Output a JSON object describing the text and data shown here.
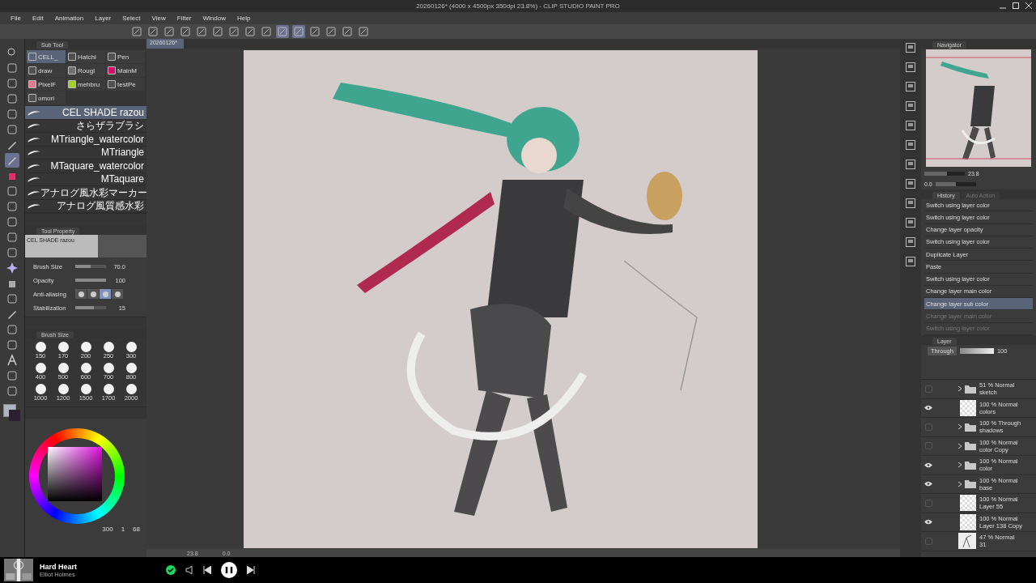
{
  "window": {
    "title": "20260126* (4000 x 4500px 350dpi 23.8%)  - CLIP STUDIO PAINT PRO"
  },
  "menu": [
    "File",
    "Edit",
    "Animation",
    "Layer",
    "Select",
    "View",
    "Filter",
    "Window",
    "Help"
  ],
  "document_tab": {
    "label": "20260126*"
  },
  "tools": [
    {
      "kind": "zoom",
      "selected": false
    },
    {
      "kind": "hand",
      "selected": false
    },
    {
      "kind": "pick",
      "selected": false
    },
    {
      "kind": "move",
      "selected": false
    },
    {
      "kind": "lasso",
      "selected": false
    },
    {
      "kind": "wand",
      "selected": false
    },
    {
      "kind": "dropper",
      "selected": false
    },
    {
      "kind": "pen",
      "selected": true
    },
    {
      "kind": "brush",
      "selected": false
    },
    {
      "kind": "airbrush",
      "selected": false
    },
    {
      "kind": "stamp",
      "selected": false
    },
    {
      "kind": "blend",
      "selected": false
    },
    {
      "kind": "eraser",
      "selected": false
    },
    {
      "kind": "frame",
      "selected": false
    },
    {
      "kind": "star",
      "selected": false
    },
    {
      "kind": "fill",
      "selected": false
    },
    {
      "kind": "gradient",
      "selected": false
    },
    {
      "kind": "line",
      "selected": false
    },
    {
      "kind": "panel",
      "selected": false
    },
    {
      "kind": "ruler",
      "selected": false
    },
    {
      "kind": "text",
      "selected": false
    },
    {
      "kind": "burst",
      "selected": false
    },
    {
      "kind": "select",
      "selected": false
    }
  ],
  "sub_tool": {
    "title": "Sub Tool",
    "groups": [
      {
        "label": "CELL_",
        "selected": true,
        "color": "#5a6478"
      },
      {
        "label": "Hatchi",
        "selected": false,
        "color": "#505050"
      },
      {
        "label": "Pen",
        "selected": false,
        "color": "#505050"
      },
      {
        "label": "draw",
        "selected": false,
        "color": "#505050"
      },
      {
        "label": "Rougl",
        "selected": false,
        "color": "#707070"
      },
      {
        "label": "MainM",
        "selected": false,
        "color": "#d0106a"
      },
      {
        "label": "PixelF",
        "selected": false,
        "color": "#e87890"
      },
      {
        "label": "mehbru",
        "selected": false,
        "color": "#a8d020"
      },
      {
        "label": "testPe",
        "selected": false,
        "color": "#505050"
      },
      {
        "label": "omori",
        "selected": false,
        "color": "#505050"
      }
    ],
    "brushes": [
      {
        "name": "CEL SHADE razou",
        "selected": true
      },
      {
        "name": "さらザラブラシ",
        "selected": false
      },
      {
        "name": "MTriangle_watercolor",
        "selected": false
      },
      {
        "name": "MTriangle",
        "selected": false
      },
      {
        "name": "MTaquare_watercolor",
        "selected": false
      },
      {
        "name": "MTaquare",
        "selected": false
      },
      {
        "name": "アナログ風水彩マーカー",
        "selected": false
      },
      {
        "name": "アナログ風質感水彩",
        "selected": false
      }
    ]
  },
  "tool_property": {
    "title": "Tool Property",
    "brush_name": "CEL SHADE razou",
    "rows": [
      {
        "kind": "slider",
        "label": "Brush Size",
        "value": "70.0",
        "level": 0.5
      },
      {
        "kind": "slider",
        "label": "Opacity",
        "value": "100",
        "level": 1
      },
      {
        "kind": "segments",
        "label": "Anti-aliasing",
        "options": [
          {
            "selected": false
          },
          {
            "selected": false
          },
          {
            "selected": true
          },
          {
            "selected": false
          }
        ]
      },
      {
        "kind": "slider",
        "label": "Stabilization",
        "value": "15",
        "level": 0.6
      }
    ]
  },
  "brush_size": {
    "title": "Brush Size",
    "sizes": [
      "150",
      "170",
      "200",
      "250",
      "300",
      "400",
      "500",
      "600",
      "700",
      "800",
      "1000",
      "1200",
      "1500",
      "1700",
      "2000"
    ]
  },
  "color_panel": {
    "readouts": [
      "300",
      "1",
      "68"
    ]
  },
  "canvas": {
    "zoom": "23.8",
    "angle": "0.0"
  },
  "navigator": {
    "title": "Navigator",
    "zoom": "23.8",
    "angle": "0.0",
    "zoom_slider": {
      "level": 0.55
    },
    "rotate_slider": {
      "level": 0.5
    }
  },
  "history": {
    "tabs": [
      {
        "label": "History",
        "selected": true
      },
      {
        "label": "Auto Action",
        "selected": false
      }
    ],
    "items": [
      {
        "label": "Switch using layer color",
        "selected": false,
        "disabled": false
      },
      {
        "label": "Switch using layer color",
        "selected": false,
        "disabled": false
      },
      {
        "label": "Change layer opacity",
        "selected": false,
        "disabled": false
      },
      {
        "label": "Switch using layer color",
        "selected": false,
        "disabled": false
      },
      {
        "label": "Duplicate Layer",
        "selected": false,
        "disabled": false
      },
      {
        "label": "Paste",
        "selected": false,
        "disabled": false
      },
      {
        "label": "Switch using layer color",
        "selected": false,
        "disabled": false
      },
      {
        "label": "Change layer main color",
        "selected": false,
        "disabled": false
      },
      {
        "label": "Change layer sub color",
        "selected": true,
        "disabled": false
      },
      {
        "label": "Change layer main color",
        "selected": false,
        "disabled": true
      },
      {
        "label": "Switch using layer color",
        "selected": false,
        "disabled": true
      }
    ]
  },
  "layers": {
    "title": "Layer",
    "blend_mode": "Through",
    "opacity": "100",
    "opacity_slider": {
      "level": 1
    },
    "items": [
      {
        "kind": "folder",
        "mode": "51 % Normal",
        "name": "sketch",
        "visible": false
      },
      {
        "kind": "raster",
        "mode": "100 % Normal",
        "name": "colors",
        "visible": true
      },
      {
        "kind": "folder",
        "mode": "100 % Through",
        "name": "shadows",
        "visible": false
      },
      {
        "kind": "folder",
        "mode": "100 % Normal",
        "name": "color Copy",
        "visible": false
      },
      {
        "kind": "folder",
        "mode": "100 % Normal",
        "name": "color",
        "visible": true
      },
      {
        "kind": "folder",
        "mode": "100 % Normal",
        "name": "base",
        "visible": true
      },
      {
        "kind": "raster",
        "mode": "100 % Normal",
        "name": "Layer 55",
        "visible": false
      },
      {
        "kind": "raster",
        "mode": "100 % Normal",
        "name": "Layer 138 Copy",
        "visible": true
      },
      {
        "kind": "sketch",
        "mode": "47 % Normal",
        "name": "31",
        "visible": false
      }
    ]
  },
  "player": {
    "title": "Hard Heart",
    "artist": "Elliot Holmes",
    "liked": true,
    "playing": true
  }
}
